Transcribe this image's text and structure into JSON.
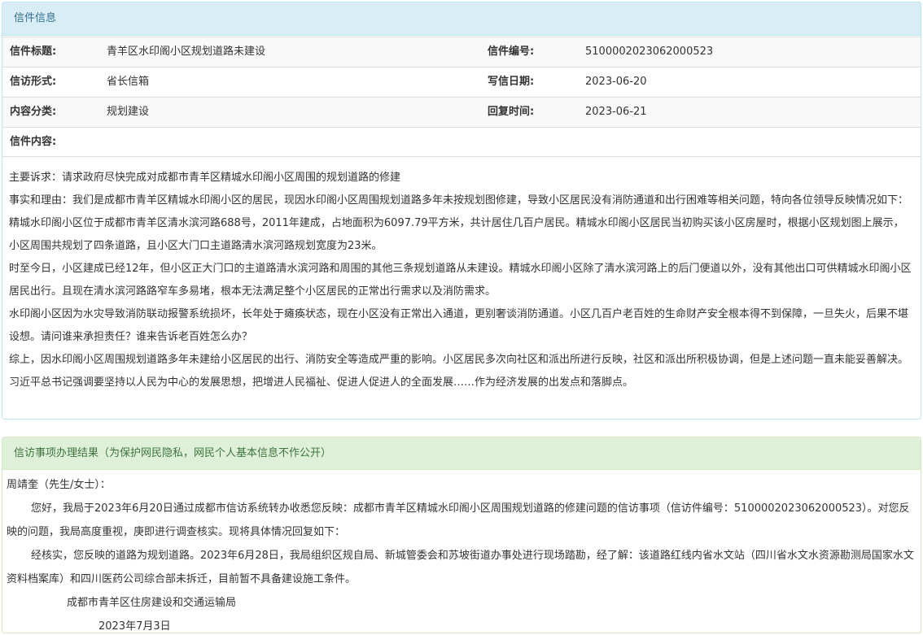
{
  "letter": {
    "header": "信件信息",
    "title_label": "信件标题:",
    "title_value": "青羊区水印阁小区规划道路未建设",
    "number_label": "信件编号:",
    "number_value": "5100002023062000523",
    "form_label": "信访形式:",
    "form_value": "省长信箱",
    "date_label": "写信日期:",
    "date_value": "2023-06-20",
    "category_label": "内容分类:",
    "category_value": "规划建设",
    "reply_time_label": "回复时间:",
    "reply_time_value": "2023-06-21",
    "content_label": "信件内容:",
    "content": [
      "主要诉求：请求政府尽快完成对成都市青羊区精城水印阁小区周围的规划道路的修建",
      "事实和理由：我们是成都市青羊区精城水印阁小区的居民，现因水印阁小区周围规划道路多年未按规划图修建，导致小区居民没有消防通道和出行困难等相关问题，特向各位领导反映情况如下：",
      "精城水印阁小区位于成都市青羊区清水滨河路688号，2011年建成，占地面积为6097.79平方米，共计居住几百户居民。精城水印阁小区居民当初购买该小区房屋时，根据小区规划图上展示，小区周围共规划了四条道路，且小区大门口主道路清水滨河路规划宽度为23米。",
      "时至今日，小区建成已经12年，但小区正大门口的主道路清水滨河路和周围的其他三条规划道路从未建设。精城水印阁小区除了清水滨河路上的后门便道以外，没有其他出口可供精城水印阁小区居民出行。且现在清水滨河路路窄车多易堵，根本无法满足整个小区居民的正常出行需求以及消防需求。",
      "水印阁小区因为水灾导致消防联动报警系统损坏，长年处于瘫痪状态，现在小区没有正常出入通道，更别奢谈消防通道。小区几百户老百姓的生命财产安全根本得不到保障，一旦失火，后果不堪设想。请问谁来承担责任？谁来告诉老百姓怎么办？",
      "综上，因水印阁小区周围规划道路多年未建给小区居民的出行、消防安全等造成严重的影响。小区居民多次向社区和派出所进行反映，社区和派出所积极协调，但是上述问题一直未能妥善解决。习近平总书记强调要坚持以人民为中心的发展思想，把增进人民福祉、促进人促进人的全面发展……作为经济发展的出发点和落脚点。"
    ]
  },
  "result": {
    "header": "信访事项办理结果（为保护网民隐私，网民个人基本信息不作公开）",
    "salutation": "周靖奎（先生/女士）：",
    "para1": "您好，我局于2023年6月20日通过成都市信访系统转办收悉您反映：成都市青羊区精城水印阁小区周围规划道路的修建问题的信访事项（信访件编号：5100002023062000523）。对您反映的问题，我局高度重视，庚即进行调查核实。现将具体情况回复如下：",
    "para2": "经核实，您反映的道路为规划道路。2023年6月28日，我局组织区规自局、新城管委会和苏坡街道办事处进行现场踏勘，经了解：该道路红线内省水文站（四川省水文水资源勘测局国家水文资料档案库）和四川医药公司综合部未拆迁，目前暂不具备建设施工条件。",
    "signature": "成都市青羊区住房建设和交通运输局",
    "sign_date": "2023年7月3日"
  }
}
